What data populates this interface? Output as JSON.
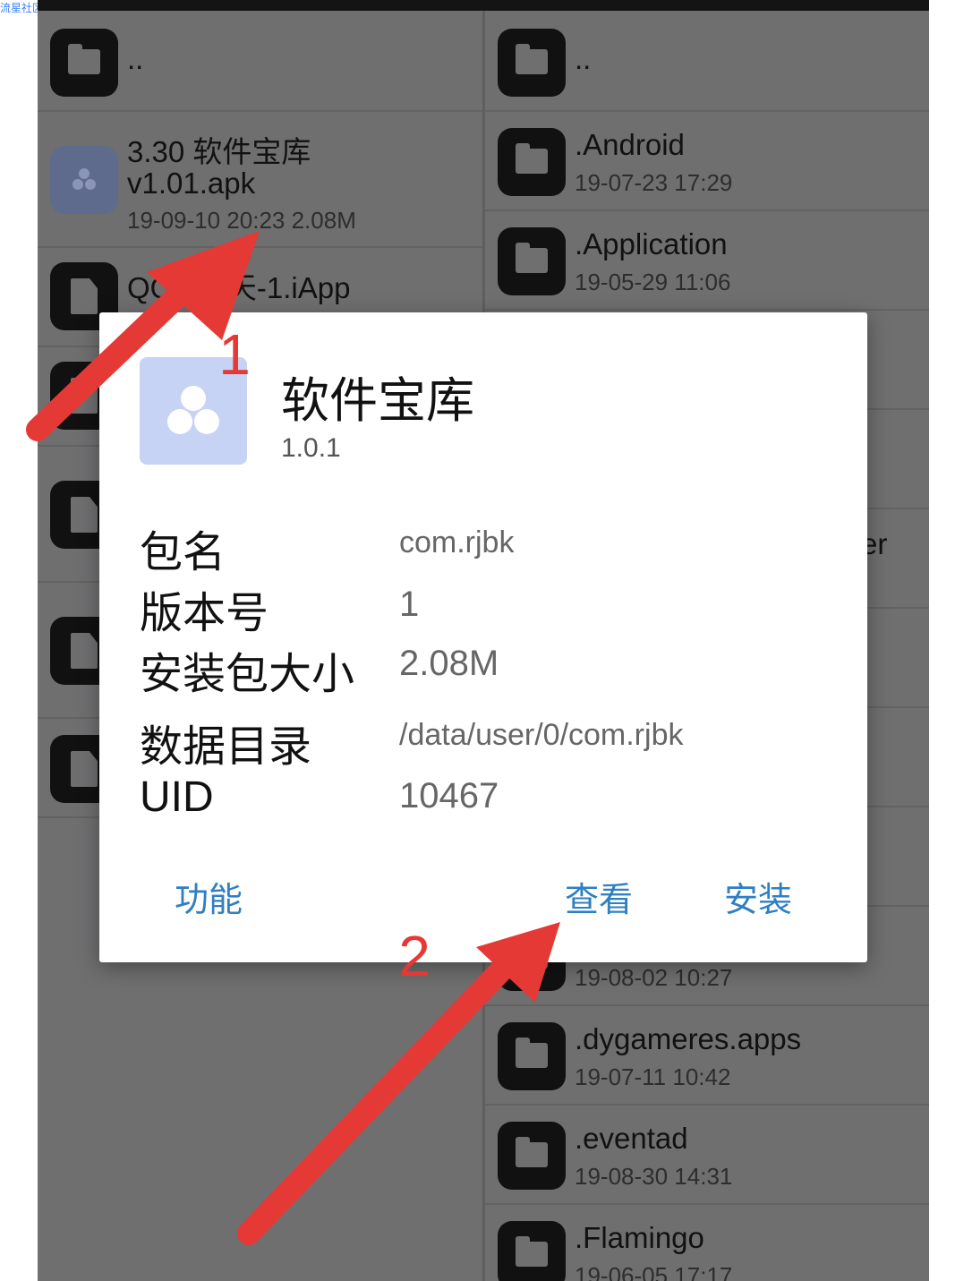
{
  "watermark": "流星社区",
  "left_pane": {
    "items": [
      {
        "name": "..",
        "meta": "",
        "icon": "folder-icon"
      },
      {
        "name": "3.30 软件宝库",
        "name2": "v1.01.apk",
        "meta": "19-09-10 20:23  2.08M",
        "icon": "apk-icon"
      },
      {
        "name": "QQ5 聊天-1.iApp",
        "meta": "",
        "icon": "file-icon"
      }
    ]
  },
  "right_pane": {
    "items": [
      {
        "name": "..",
        "meta": "",
        "icon": "folder-icon"
      },
      {
        "name": ".Android",
        "meta": "19-07-23 17:29",
        "icon": "folder-icon"
      },
      {
        "name": ".Application",
        "meta": "19-05-29 11:06",
        "icon": "folder-icon"
      },
      {
        "name": "er",
        "meta": "",
        "icon": "folder-icon"
      },
      {
        "name": "",
        "meta": "19-08-02 10:27",
        "icon": "folder-icon"
      },
      {
        "name": ".dygameres.apps",
        "meta": "19-07-11 10:42",
        "icon": "folder-icon"
      },
      {
        "name": ".eventad",
        "meta": "19-08-30 14:31",
        "icon": "folder-icon"
      },
      {
        "name": ".Flamingo",
        "meta": "19-06-05 17:17",
        "icon": "folder-icon"
      }
    ]
  },
  "dialog": {
    "app_name": "软件宝库",
    "app_version": "1.0.1",
    "rows": [
      {
        "label": "包名",
        "value": "com.rjbk"
      },
      {
        "label": "版本号",
        "value": "1"
      },
      {
        "label": "安装包大小",
        "value": "2.08M"
      },
      {
        "label": "数据目录",
        "value": "/data/user/0/com.rjbk"
      },
      {
        "label": "UID",
        "value": "10467"
      }
    ],
    "buttons": {
      "function": "功能",
      "view": "查看",
      "install": "安装"
    }
  },
  "annotations": {
    "step1": "1",
    "step2": "2",
    "color": "#e53935"
  },
  "colors": {
    "accent": "#2f7fc1",
    "icon_bg": "#c7d3f5",
    "dim_background": "#6f6f70"
  }
}
